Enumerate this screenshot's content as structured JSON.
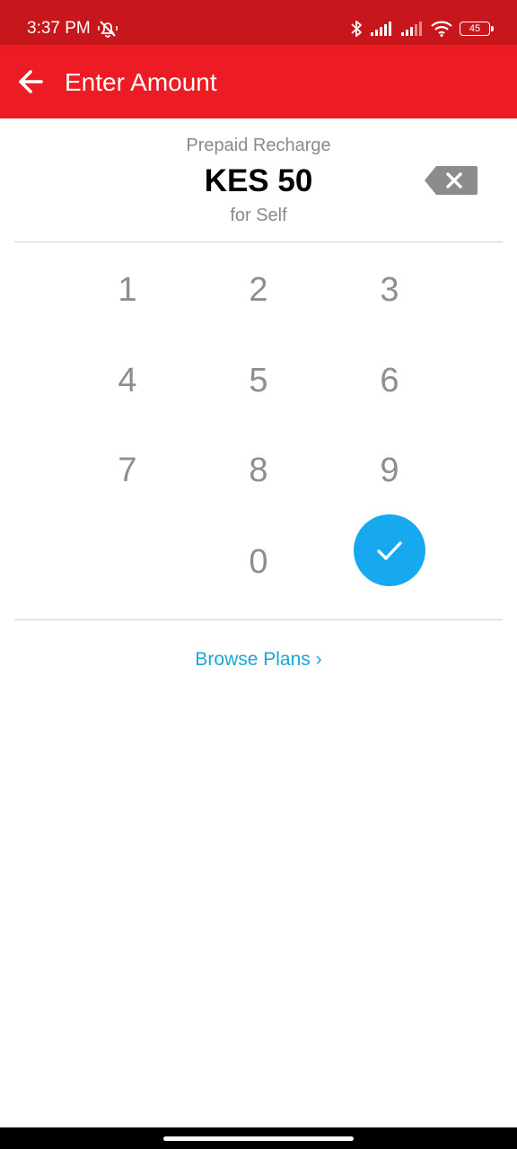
{
  "status_bar": {
    "time": "3:37 PM",
    "battery": "45",
    "background_color": "#c8161d",
    "icons": [
      "mute-icon",
      "bluetooth-icon",
      "signal-icon",
      "signal-icon",
      "wifi-icon",
      "battery-icon"
    ]
  },
  "header": {
    "title": "Enter Amount",
    "back_icon": "arrow-left-icon",
    "background_color": "#ed1c24"
  },
  "amount_panel": {
    "label": "Prepaid Recharge",
    "amount": "KES 50",
    "for_label": "for Self",
    "backspace_icon": "backspace-icon"
  },
  "keypad": {
    "keys": [
      "1",
      "2",
      "3",
      "4",
      "5",
      "6",
      "7",
      "8",
      "9",
      "0"
    ],
    "confirm_icon": "check-icon",
    "confirm_color": "#17a9ef"
  },
  "browse": {
    "label": "Browse Plans ›",
    "color": "#1aa6d6"
  }
}
